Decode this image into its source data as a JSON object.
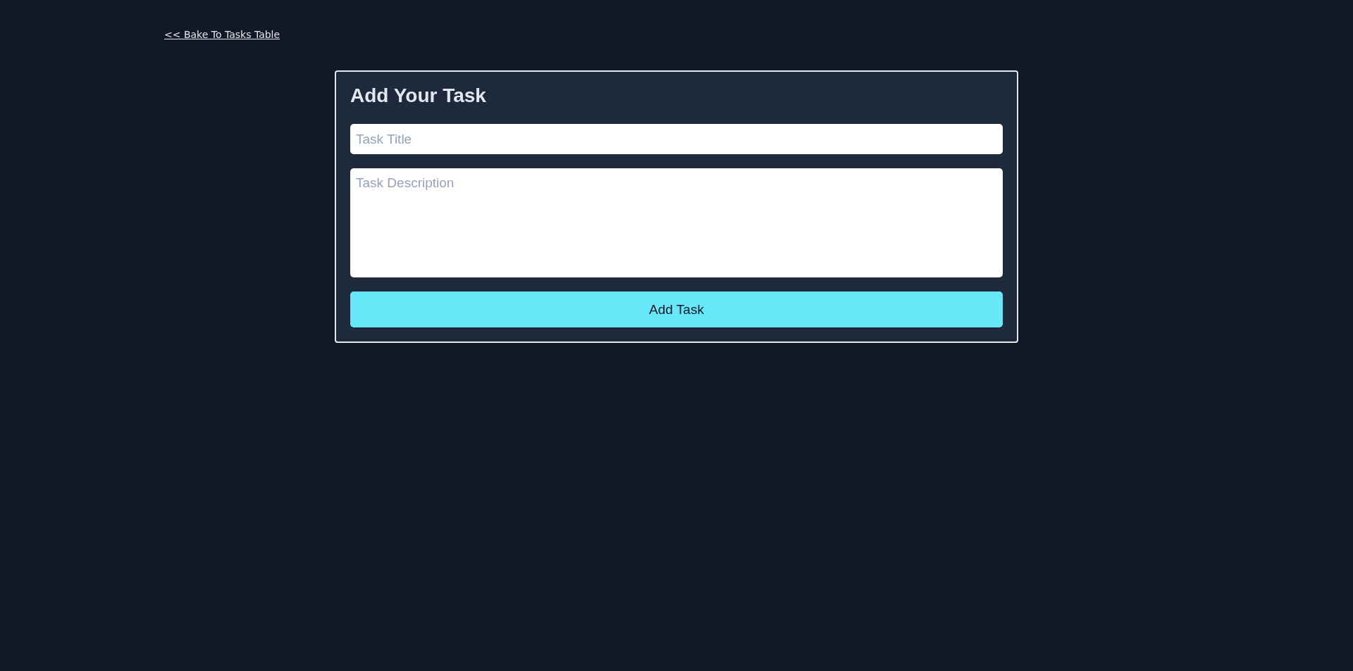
{
  "back_link": {
    "label": "<< Bake To Tasks Table"
  },
  "form": {
    "title": "Add Your Task",
    "fields": [
      {
        "kind": "input",
        "placeholder": "Task Title"
      },
      {
        "kind": "textarea",
        "placeholder": "Task Description"
      }
    ],
    "submit_button": {
      "label": "Add Task"
    }
  }
}
